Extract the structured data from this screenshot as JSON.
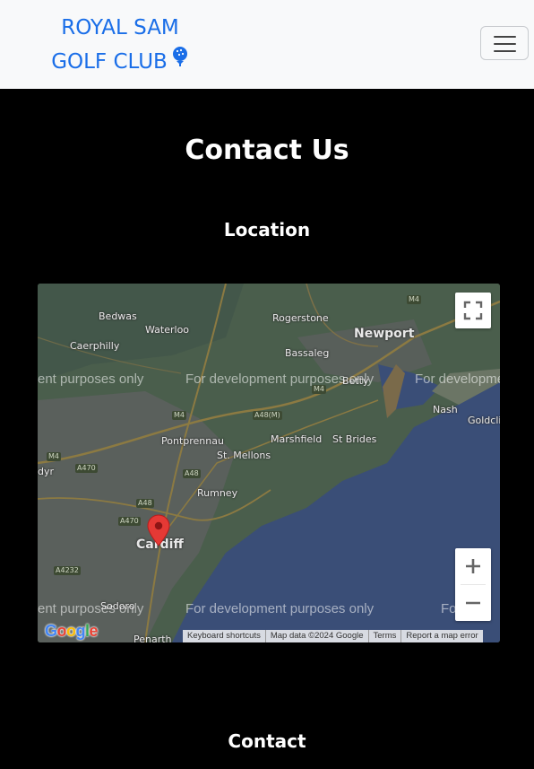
{
  "navbar": {
    "brand_line1": "ROYAL SAM",
    "brand_line2": "GOLF CLUB",
    "brand_icon": "golf-ball-tee-icon",
    "toggler_icon": "hamburger-menu-icon",
    "brand_color": "#1a6ee8"
  },
  "page": {
    "title": "Contact Us",
    "location_heading": "Location",
    "contact_heading": "Contact"
  },
  "map": {
    "places": {
      "bedwas": "Bedwas",
      "rogerstone": "Rogerstone",
      "waterloo": "Waterloo",
      "newport": "Newport",
      "caerphilly": "Caerphilly",
      "bassaleg": "Bassaleg",
      "nash": "Nash",
      "goldcliff": "Goldcli",
      "pontprennau": "Pontprennau",
      "marshfield": "Marshfield",
      "st_brides": "St Brides",
      "st_mellons": "St. Mellons",
      "rumney": "Rumney",
      "cardiff": "Cardiff",
      "penarth": "Penarth",
      "sodoro": "Sodoro",
      "dyr": "dyr",
      "bettws": "Betty"
    },
    "roads": [
      "M4",
      "M4",
      "A48(M)",
      "M4",
      "A470",
      "A48",
      "A48",
      "A470",
      "A4232",
      "M4"
    ],
    "watermark": "For development purposes only",
    "watermark_left": "ent purposes only",
    "watermark_right": "For developme",
    "watermark_right2": "For dev",
    "watermark_bottom_left": "ent purposes only",
    "zoom_in_icon": "plus-icon",
    "zoom_out_icon": "minus-icon",
    "fullscreen_icon": "fullscreen-icon",
    "google_logo": "Google",
    "attribution": {
      "keyboard_shortcuts": "Keyboard shortcuts",
      "map_data": "Map data ©2024 Google",
      "terms": "Terms",
      "report": "Report a map error"
    },
    "marker_icon": "map-pin-icon",
    "marker_color": "#e53935",
    "water_color": "#3a4e77",
    "land_color": "#4a5e4c"
  }
}
